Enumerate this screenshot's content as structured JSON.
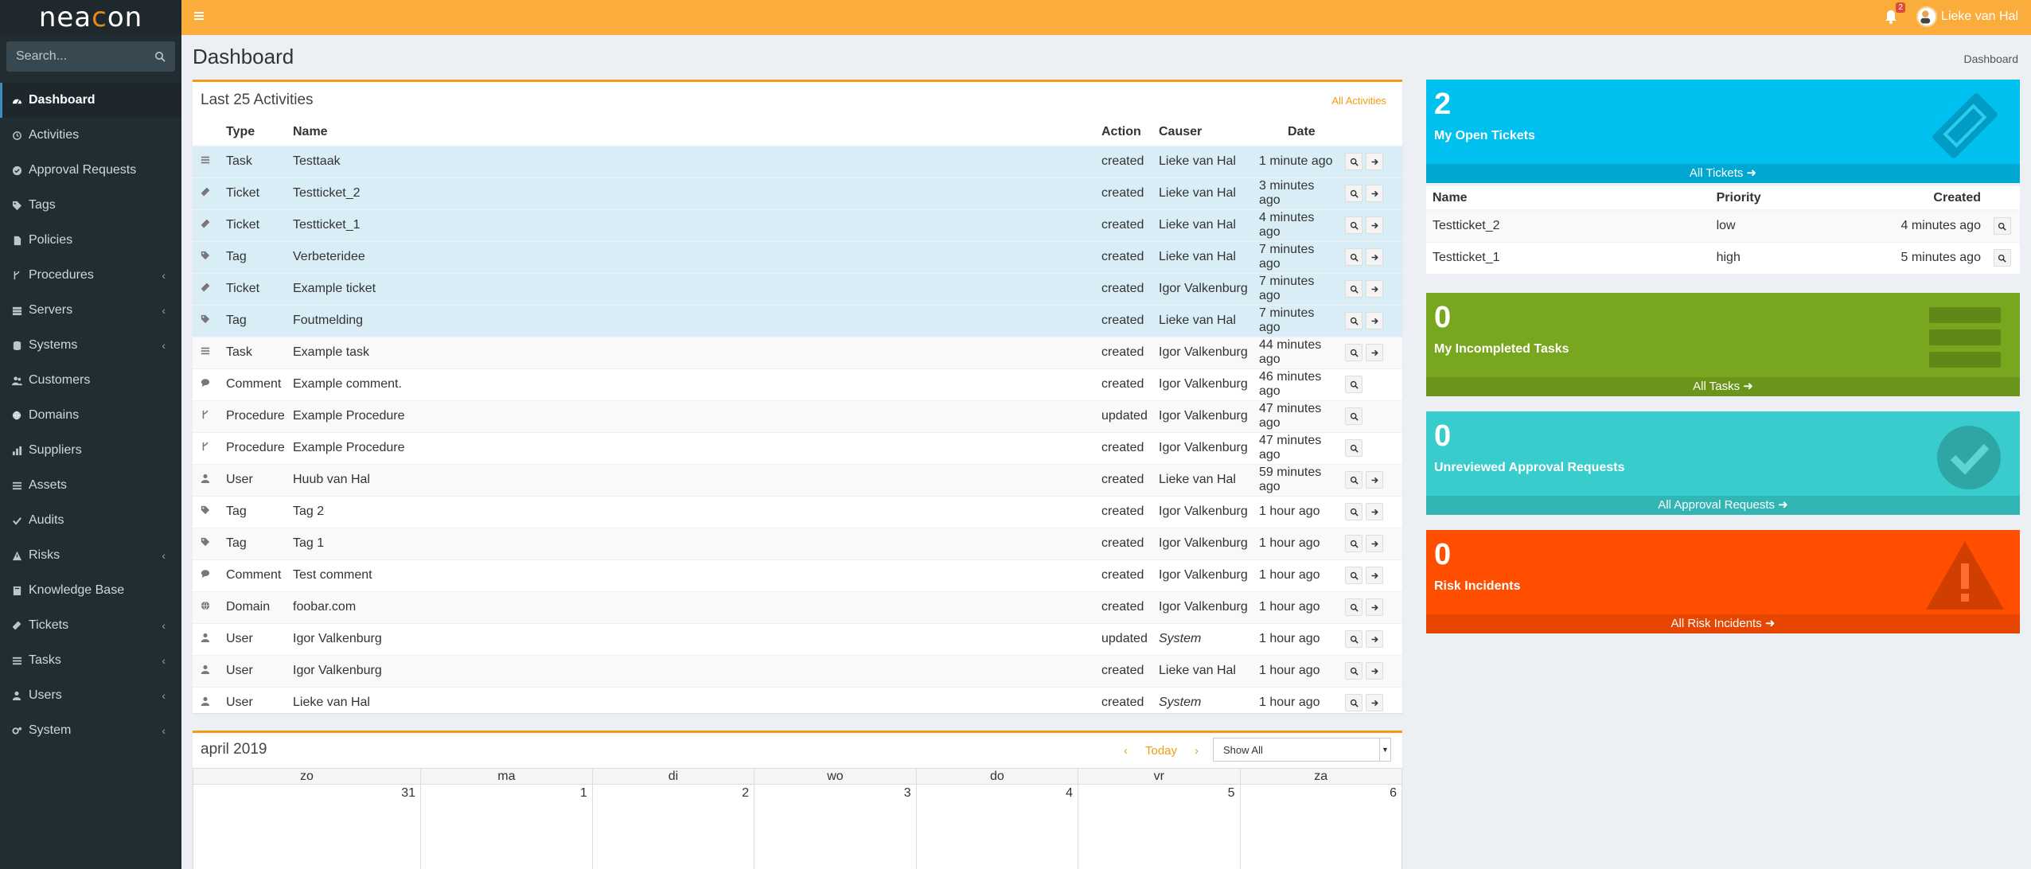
{
  "app": {
    "logo_pre": "nea",
    "logo_mid": "c",
    "logo_post": "on",
    "search_placeholder": "Search...",
    "user_name": "Lieke van Hal",
    "notification_count": "2"
  },
  "sidebar": {
    "items": [
      {
        "label": "Dashboard",
        "icon": "dashboard-icon",
        "chevron": ""
      },
      {
        "label": "Activities",
        "icon": "history-icon",
        "chevron": ""
      },
      {
        "label": "Approval Requests",
        "icon": "check-circle-icon",
        "chevron": ""
      },
      {
        "label": "Tags",
        "icon": "tags-icon",
        "chevron": ""
      },
      {
        "label": "Policies",
        "icon": "file-icon",
        "chevron": ""
      },
      {
        "label": "Procedures",
        "icon": "fork-icon",
        "chevron": "‹"
      },
      {
        "label": "Servers",
        "icon": "server-icon",
        "chevron": "‹"
      },
      {
        "label": "Systems",
        "icon": "database-icon",
        "chevron": "‹"
      },
      {
        "label": "Customers",
        "icon": "users-icon",
        "chevron": ""
      },
      {
        "label": "Domains",
        "icon": "globe-icon",
        "chevron": ""
      },
      {
        "label": "Suppliers",
        "icon": "bar-chart-icon",
        "chevron": ""
      },
      {
        "label": "Assets",
        "icon": "list-icon",
        "chevron": ""
      },
      {
        "label": "Audits",
        "icon": "check-icon",
        "chevron": ""
      },
      {
        "label": "Risks",
        "icon": "warning-icon",
        "chevron": "‹"
      },
      {
        "label": "Knowledge Base",
        "icon": "book-icon",
        "chevron": ""
      },
      {
        "label": "Tickets",
        "icon": "ticket-icon",
        "chevron": "‹"
      },
      {
        "label": "Tasks",
        "icon": "tasks-icon",
        "chevron": "‹"
      },
      {
        "label": "Users",
        "icon": "user-icon",
        "chevron": "‹"
      },
      {
        "label": "System",
        "icon": "cogs-icon",
        "chevron": "‹"
      }
    ]
  },
  "header": {
    "title": "Dashboard",
    "breadcrumb": "Dashboard"
  },
  "activities": {
    "title": "Last 25 Activities",
    "link": "All Activities",
    "columns": [
      "Type",
      "Name",
      "Action",
      "Causer",
      "Date"
    ],
    "rows": [
      {
        "icon": "task-icon",
        "type": "Task",
        "name": "Testtaak",
        "action": "created",
        "causer": "Lieke van Hal",
        "date": "1 minute ago",
        "system": false,
        "go": true,
        "hl": true
      },
      {
        "icon": "ticket-icon",
        "type": "Ticket",
        "name": "Testticket_2",
        "action": "created",
        "causer": "Lieke van Hal",
        "date": "3 minutes ago",
        "system": false,
        "go": true,
        "hl": true
      },
      {
        "icon": "ticket-icon",
        "type": "Ticket",
        "name": "Testticket_1",
        "action": "created",
        "causer": "Lieke van Hal",
        "date": "4 minutes ago",
        "system": false,
        "go": true,
        "hl": true
      },
      {
        "icon": "tag-icon",
        "type": "Tag",
        "name": "Verbeteridee",
        "action": "created",
        "causer": "Lieke van Hal",
        "date": "7 minutes ago",
        "system": false,
        "go": true,
        "hl": true
      },
      {
        "icon": "ticket-icon",
        "type": "Ticket",
        "name": "Example ticket",
        "action": "created",
        "causer": "Igor Valkenburg",
        "date": "7 minutes ago",
        "system": false,
        "go": true,
        "hl": true
      },
      {
        "icon": "tag-icon",
        "type": "Tag",
        "name": "Foutmelding",
        "action": "created",
        "causer": "Lieke van Hal",
        "date": "7 minutes ago",
        "system": false,
        "go": true,
        "hl": true
      },
      {
        "icon": "task-icon",
        "type": "Task",
        "name": "Example task",
        "action": "created",
        "causer": "Igor Valkenburg",
        "date": "44 minutes ago",
        "system": false,
        "go": true,
        "hl": false
      },
      {
        "icon": "comment-icon",
        "type": "Comment",
        "name": "Example comment.",
        "action": "created",
        "causer": "Igor Valkenburg",
        "date": "46 minutes ago",
        "system": false,
        "go": false,
        "hl": false
      },
      {
        "icon": "fork-icon",
        "type": "Procedure",
        "name": "Example Procedure",
        "action": "updated",
        "causer": "Igor Valkenburg",
        "date": "47 minutes ago",
        "system": false,
        "go": false,
        "hl": false
      },
      {
        "icon": "fork-icon",
        "type": "Procedure",
        "name": "Example Procedure",
        "action": "created",
        "causer": "Igor Valkenburg",
        "date": "47 minutes ago",
        "system": false,
        "go": false,
        "hl": false
      },
      {
        "icon": "user-icon",
        "type": "User",
        "name": "Huub van Hal",
        "action": "created",
        "causer": "Lieke van Hal",
        "date": "59 minutes ago",
        "system": false,
        "go": true,
        "hl": false
      },
      {
        "icon": "tag-icon",
        "type": "Tag",
        "name": "Tag 2",
        "action": "created",
        "causer": "Igor Valkenburg",
        "date": "1 hour ago",
        "system": false,
        "go": true,
        "hl": false
      },
      {
        "icon": "tag-icon",
        "type": "Tag",
        "name": "Tag 1",
        "action": "created",
        "causer": "Igor Valkenburg",
        "date": "1 hour ago",
        "system": false,
        "go": true,
        "hl": false
      },
      {
        "icon": "comment-icon",
        "type": "Comment",
        "name": "Test comment",
        "action": "created",
        "causer": "Igor Valkenburg",
        "date": "1 hour ago",
        "system": false,
        "go": true,
        "hl": false
      },
      {
        "icon": "globe-icon",
        "type": "Domain",
        "name": "foobar.com",
        "action": "created",
        "causer": "Igor Valkenburg",
        "date": "1 hour ago",
        "system": false,
        "go": true,
        "hl": false
      },
      {
        "icon": "user-icon",
        "type": "User",
        "name": "Igor Valkenburg",
        "action": "updated",
        "causer": "System",
        "date": "1 hour ago",
        "system": true,
        "go": true,
        "hl": false
      },
      {
        "icon": "user-icon",
        "type": "User",
        "name": "Igor Valkenburg",
        "action": "created",
        "causer": "Lieke van Hal",
        "date": "1 hour ago",
        "system": false,
        "go": true,
        "hl": false
      },
      {
        "icon": "user-icon",
        "type": "User",
        "name": "Lieke van Hal",
        "action": "created",
        "causer": "System",
        "date": "1 hour ago",
        "system": true,
        "go": true,
        "hl": false
      }
    ]
  },
  "calendar": {
    "title": "april 2019",
    "today": "Today",
    "prev": "‹",
    "next": "›",
    "filter_value": "Show All",
    "days": [
      "zo",
      "ma",
      "di",
      "wo",
      "do",
      "vr",
      "za"
    ],
    "dates": [
      "31",
      "1",
      "2",
      "3",
      "4",
      "5",
      "6"
    ]
  },
  "cards": {
    "tickets": {
      "count": "2",
      "label": "My Open Tickets",
      "footer": "All Tickets",
      "color": "#00c0ef",
      "footer_color": "#00a7d0"
    },
    "tasks": {
      "count": "0",
      "label": "My Incompleted Tasks",
      "footer": "All Tasks",
      "color": "#78a61e",
      "footer_color": "#6a941a"
    },
    "approvals": {
      "count": "0",
      "label": "Unreviewed Approval Requests",
      "footer": "All Approval Requests",
      "color": "#39cccc",
      "footer_color": "#31b5b5"
    },
    "risks": {
      "count": "0",
      "label": "Risk Incidents",
      "footer": "All Risk Incidents",
      "color": "#ff4e00",
      "footer_color": "#e64600"
    }
  },
  "open_tickets": {
    "columns": [
      "Name",
      "Priority",
      "Created"
    ],
    "rows": [
      {
        "name": "Testticket_2",
        "priority": "low",
        "created": "4 minutes ago"
      },
      {
        "name": "Testticket_1",
        "priority": "high",
        "created": "5 minutes ago"
      }
    ]
  }
}
